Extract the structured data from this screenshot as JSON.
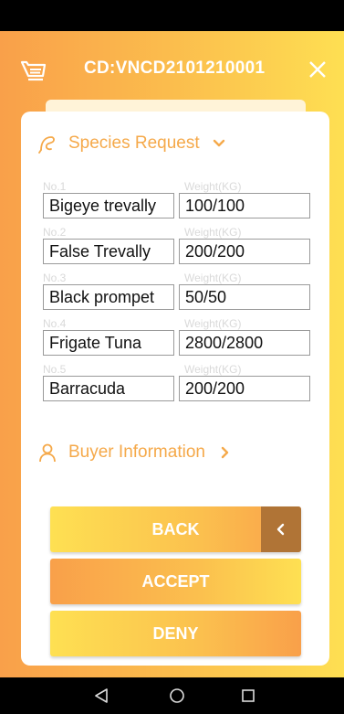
{
  "header": {
    "title": "CD:VNCD2101210001",
    "cart_icon": "cart-icon",
    "close_icon": "close-icon"
  },
  "species_section": {
    "title": "Species Request",
    "icon": "fish-icon",
    "expanded": true,
    "weight_label": "Weight(KG)",
    "items": [
      {
        "no": "No.1",
        "name": "Bigeye trevally",
        "weight": "100/100"
      },
      {
        "no": "No.2",
        "name": "False Trevally",
        "weight": "200/200"
      },
      {
        "no": "No.3",
        "name": "Black prompet",
        "weight": "50/50"
      },
      {
        "no": "No.4",
        "name": "Frigate Tuna",
        "weight": "2800/2800"
      },
      {
        "no": "No.5",
        "name": "Barracuda",
        "weight": "200/200"
      }
    ]
  },
  "buyer_section": {
    "title": "Buyer Information",
    "icon": "person-icon",
    "expanded": false
  },
  "buttons": {
    "back": "BACK",
    "accept": "ACCEPT",
    "deny": "DENY"
  },
  "colors": {
    "accent": "#f5a94a",
    "gradient_orange": "#f9a04a",
    "gradient_yellow": "#fedf52",
    "back_arrow_bg": "#b07436"
  }
}
